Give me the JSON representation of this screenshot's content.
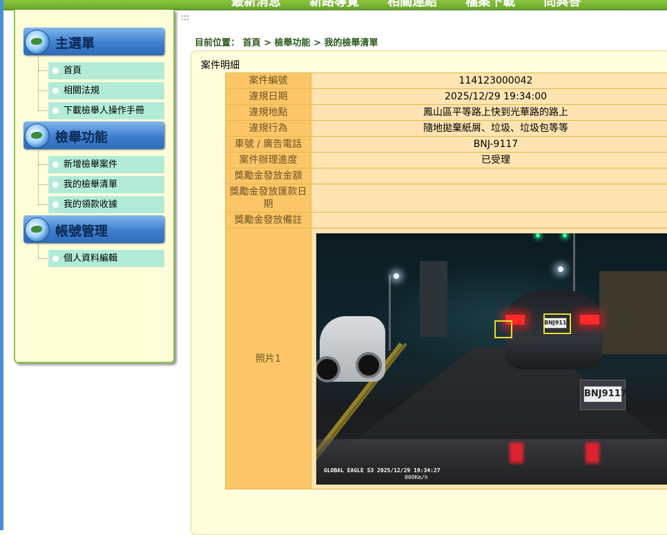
{
  "top_nav": [
    "最新消息",
    "新路導覽",
    "相關連結",
    "檔案下載",
    "問與答"
  ],
  "sidebar": {
    "sections": [
      {
        "title": "主選單",
        "items": [
          "首頁",
          "相關法規",
          "下載檢舉人操作手冊"
        ]
      },
      {
        "title": "檢舉功能",
        "items": [
          "新增檢舉案件",
          "我的檢舉清單",
          "我的領款收據"
        ]
      },
      {
        "title": "帳號管理",
        "items": [
          "個人資料編輯"
        ]
      }
    ]
  },
  "dots_mark": ":::",
  "breadcrumb": {
    "prefix": "目前位置：",
    "items": [
      "首頁",
      "檢舉功能",
      "我的檢舉清單"
    ],
    "separator": ">"
  },
  "panel_title": "案件明細",
  "details": [
    {
      "label": "案件編號",
      "value": "114123000042"
    },
    {
      "label": "違規日期",
      "value": "2025/12/29 19:34:00"
    },
    {
      "label": "違規地點",
      "value": "鳳山區平等路上快到光華路的路上"
    },
    {
      "label": "違規行為",
      "value": "隨地拋棄紙屑、垃圾、垃圾包等等"
    },
    {
      "label": "車號 / 廣告電話",
      "value": "BNJ-9117"
    },
    {
      "label": "案件辦理進度",
      "value": "已受理",
      "status_color": "#e00000"
    },
    {
      "label": "獎勵金發放金額",
      "value": ""
    },
    {
      "label": "獎勵金發放匯款日期",
      "value": ""
    },
    {
      "label": "獎勵金發放備註",
      "value": ""
    }
  ],
  "photo": {
    "label": "照片1",
    "plate_text": "BNJ9117",
    "camera_stamp": "GLOBAL EAGLE S3  2025/12/29 19:34:27",
    "speed_stamp": "000Km/h"
  },
  "colors": {
    "label_bg": "#fcc668",
    "value_bg": "#fde4b0",
    "menu_item_bg": "#b2ecd8",
    "sidebar_bg": "#fffdd8",
    "topbar_green": "#8cc63f"
  }
}
